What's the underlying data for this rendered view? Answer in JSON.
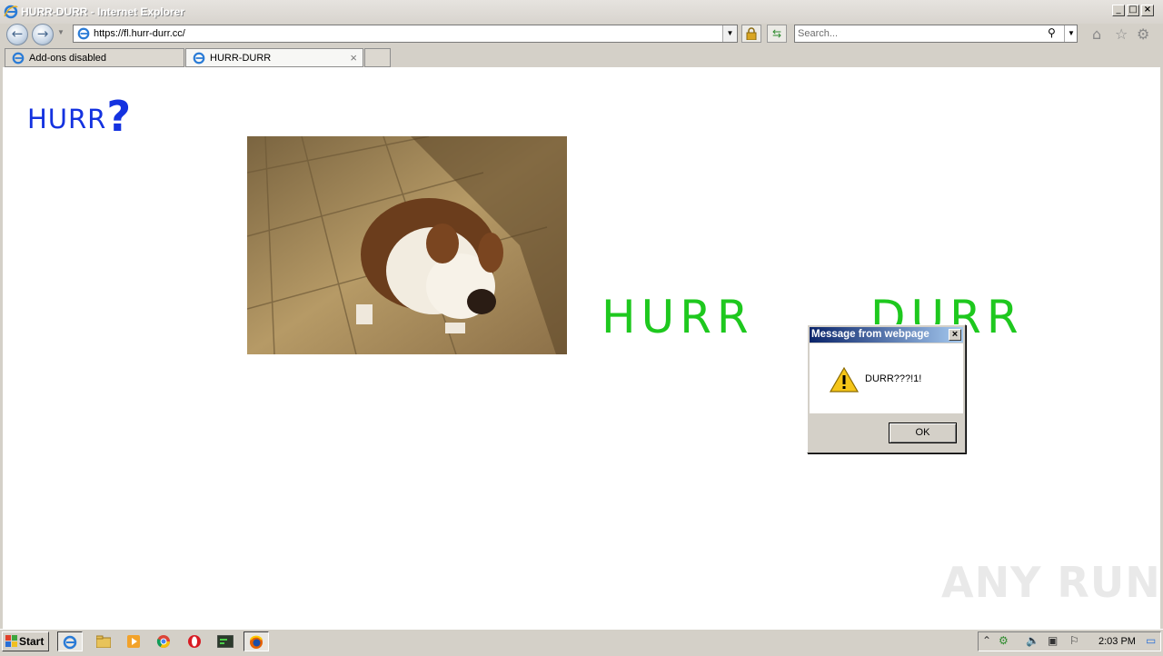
{
  "window": {
    "title": "HURR-DURR - Internet Explorer",
    "controls": [
      "minimize",
      "maximize",
      "close"
    ]
  },
  "address_bar": {
    "url": "https://fl.hurr-durr.cc/",
    "icons": [
      "back-icon",
      "forward-icon",
      "lock-icon",
      "refresh-icon"
    ]
  },
  "search": {
    "placeholder": "Search..."
  },
  "tabs": [
    {
      "label": "Add-ons disabled",
      "active": false
    },
    {
      "label": "HURR-DURR",
      "active": true,
      "close": "×"
    }
  ],
  "page": {
    "heading": "HURR",
    "heading_mark": "?",
    "left_word": "HURR",
    "right_word": "DURR",
    "colors": {
      "heading": "#1432e0",
      "words": "#1ec81e"
    }
  },
  "dialog": {
    "title": "Message from webpage",
    "message": "DURR???!1!",
    "ok_label": "OK",
    "icon": "warning-icon"
  },
  "watermark": "ANY RUN",
  "taskbar": {
    "start_label": "Start",
    "pinned_icons": [
      "internet-explorer-icon",
      "folder-icon",
      "media-player-icon",
      "chrome-icon",
      "opera-icon",
      "terminal-icon",
      "firefox-icon"
    ],
    "clock": "2:03 PM"
  }
}
